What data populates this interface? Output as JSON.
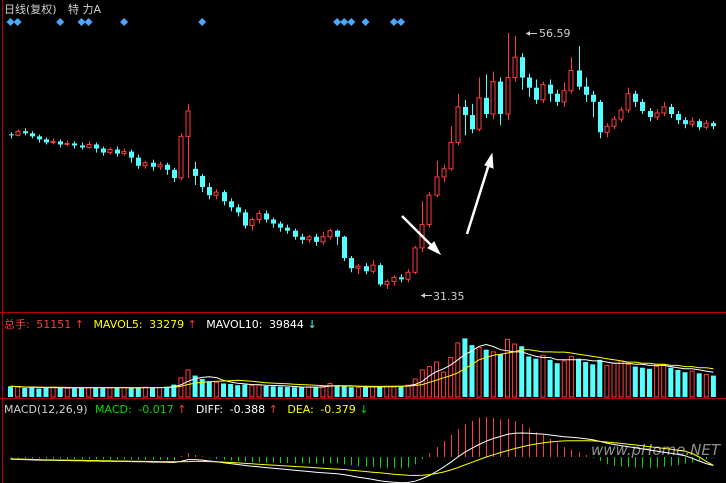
{
  "header": {
    "title": "日线(复权)",
    "extra": "特 力A"
  },
  "price_panel": {
    "high_label": "56.59",
    "low_label": "31.35"
  },
  "volume_panel": {
    "total_label": "总手:",
    "total_value": "51151",
    "total_arrow": "↑",
    "mavol5_label": "MAVOL5:",
    "mavol5_value": "33279",
    "mavol5_arrow": "↑",
    "mavol10_label": "MAVOL10:",
    "mavol10_value": "39844",
    "mavol10_arrow": "↓"
  },
  "macd_panel": {
    "name": "MACD(12,26,9)",
    "macd_label": "MACD:",
    "macd_value": "-0.017",
    "macd_arrow": "↑",
    "diff_label": "DIFF:",
    "diff_value": "-0.388",
    "diff_arrow": "↑",
    "dea_label": "DEA:",
    "dea_value": "-0.379",
    "dea_arrow": "↓"
  },
  "watermark": "www.pHome.NET",
  "colors": {
    "up": "#ff3c3c",
    "down": "#54ffff",
    "grid": "#b00000",
    "mavol5": "#ffffff",
    "mavol10": "#ffff00",
    "macd_pos": "#ff3c3c",
    "macd_neg": "#00d800",
    "marker": "#4aa8ff"
  },
  "chart_data": {
    "type": "candlestick",
    "price_high": 56.59,
    "price_low": 31.35,
    "candles": [
      [
        46.6,
        46.5,
        46.8,
        46.2
      ],
      [
        46.5,
        46.9,
        47.1,
        46.4
      ],
      [
        46.9,
        46.7,
        47.2,
        46.5
      ],
      [
        46.7,
        46.4,
        46.9,
        46.2
      ],
      [
        46.4,
        46.1,
        46.6,
        45.8
      ],
      [
        46.1,
        45.8,
        46.3,
        45.6
      ],
      [
        45.8,
        45.9,
        46.2,
        45.6
      ],
      [
        45.9,
        45.6,
        46.1,
        45.3
      ],
      [
        45.6,
        45.7,
        46.0,
        45.4
      ],
      [
        45.7,
        45.5,
        45.9,
        45.2
      ],
      [
        45.5,
        45.3,
        45.8,
        45.1
      ],
      [
        45.3,
        45.6,
        45.9,
        45.2
      ],
      [
        45.6,
        45.2,
        45.8,
        44.8
      ],
      [
        45.2,
        44.8,
        45.4,
        44.5
      ],
      [
        44.8,
        45.1,
        45.3,
        44.6
      ],
      [
        45.1,
        44.7,
        45.4,
        44.4
      ],
      [
        44.7,
        44.9,
        45.2,
        44.5
      ],
      [
        44.9,
        44.3,
        45.1,
        43.8
      ],
      [
        44.3,
        43.5,
        44.6,
        43.2
      ],
      [
        43.5,
        43.8,
        44.0,
        43.2
      ],
      [
        43.8,
        43.4,
        44.1,
        43.0
      ],
      [
        43.4,
        43.6,
        43.9,
        43.1
      ],
      [
        43.6,
        43.1,
        43.8,
        42.6
      ],
      [
        43.1,
        42.3,
        43.3,
        41.9
      ],
      [
        42.3,
        46.4,
        46.7,
        42.1
      ],
      [
        46.4,
        48.9,
        49.6,
        42.3
      ],
      [
        43.2,
        42.5,
        43.9,
        41.6
      ],
      [
        42.5,
        41.4,
        42.7,
        40.9
      ],
      [
        41.4,
        40.6,
        41.8,
        40.2
      ],
      [
        40.6,
        40.9,
        41.2,
        40.2
      ],
      [
        40.9,
        40.0,
        41.1,
        39.6
      ],
      [
        40.0,
        39.4,
        40.3,
        39.0
      ],
      [
        39.4,
        38.9,
        39.7,
        38.5
      ],
      [
        38.9,
        37.6,
        39.2,
        37.3
      ],
      [
        37.6,
        38.2,
        38.4,
        37.1
      ],
      [
        38.2,
        38.8,
        39.1,
        37.8
      ],
      [
        38.8,
        38.2,
        39.1,
        37.9
      ],
      [
        38.2,
        37.8,
        38.4,
        37.4
      ],
      [
        37.8,
        37.4,
        38.0,
        37.0
      ],
      [
        37.4,
        37.1,
        37.7,
        36.8
      ],
      [
        37.1,
        36.5,
        37.3,
        36.2
      ],
      [
        36.5,
        36.2,
        36.8,
        35.8
      ],
      [
        36.2,
        36.5,
        36.7,
        35.9
      ],
      [
        36.5,
        36.0,
        36.8,
        35.6
      ],
      [
        36.0,
        36.5,
        37.0,
        35.7
      ],
      [
        36.5,
        37.1,
        37.3,
        36.2
      ],
      [
        37.1,
        36.5,
        37.2,
        35.7
      ],
      [
        36.5,
        34.4,
        36.6,
        34.1
      ],
      [
        34.4,
        33.4,
        34.6,
        33.0
      ],
      [
        33.4,
        33.6,
        33.8,
        32.8
      ],
      [
        33.6,
        33.1,
        33.9,
        32.8
      ],
      [
        33.1,
        33.7,
        34.2,
        32.9
      ],
      [
        33.7,
        31.8,
        33.9,
        31.6
      ],
      [
        31.8,
        32.1,
        32.3,
        31.35
      ],
      [
        32.1,
        32.5,
        32.7,
        31.7
      ],
      [
        32.5,
        32.3,
        32.8,
        32.0
      ],
      [
        32.3,
        33.0,
        33.3,
        32.0
      ],
      [
        33.0,
        35.4,
        35.6,
        32.8
      ],
      [
        35.4,
        37.7,
        40.0,
        35.0
      ],
      [
        37.7,
        40.6,
        40.9,
        37.4
      ],
      [
        40.6,
        42.4,
        44.0,
        40.4
      ],
      [
        42.4,
        43.2,
        43.6,
        41.9
      ],
      [
        43.2,
        45.8,
        47.4,
        43.0
      ],
      [
        45.8,
        49.3,
        50.6,
        45.5
      ],
      [
        49.3,
        48.5,
        50.0,
        46.5
      ],
      [
        48.5,
        47.1,
        49.6,
        46.7
      ],
      [
        47.1,
        50.2,
        52.2,
        46.9
      ],
      [
        50.2,
        48.6,
        52.5,
        48.2
      ],
      [
        48.6,
        51.8,
        52.8,
        48.1
      ],
      [
        51.8,
        48.6,
        52.2,
        47.5
      ],
      [
        48.6,
        52.2,
        56.59,
        48.0
      ],
      [
        52.2,
        54.2,
        56.3,
        51.8
      ],
      [
        54.2,
        52.2,
        54.6,
        51.0
      ],
      [
        52.2,
        51.2,
        52.6,
        50.3
      ],
      [
        51.2,
        50.0,
        52.0,
        49.6
      ],
      [
        50.0,
        51.5,
        51.8,
        49.7
      ],
      [
        51.5,
        50.6,
        52.0,
        49.8
      ],
      [
        50.6,
        49.8,
        51.0,
        49.4
      ],
      [
        49.8,
        50.9,
        51.7,
        49.3
      ],
      [
        50.9,
        52.9,
        54.2,
        50.6
      ],
      [
        52.9,
        51.3,
        55.3,
        51.0
      ],
      [
        51.3,
        50.5,
        52.2,
        49.8
      ],
      [
        50.5,
        49.8,
        50.9,
        48.3
      ],
      [
        49.8,
        46.8,
        50.0,
        46.2
      ],
      [
        46.8,
        47.4,
        47.7,
        46.3
      ],
      [
        47.4,
        48.1,
        48.4,
        47.1
      ],
      [
        48.1,
        49.0,
        49.3,
        47.8
      ],
      [
        49.0,
        50.6,
        51.2,
        48.7
      ],
      [
        50.6,
        49.8,
        50.9,
        49.3
      ],
      [
        49.8,
        48.9,
        50.1,
        48.6
      ],
      [
        48.9,
        48.3,
        49.2,
        47.9
      ],
      [
        48.3,
        48.7,
        49.1,
        48.0
      ],
      [
        48.7,
        49.3,
        49.8,
        48.4
      ],
      [
        49.3,
        48.6,
        49.6,
        48.2
      ],
      [
        48.6,
        48.0,
        48.9,
        47.6
      ],
      [
        48.0,
        47.6,
        48.3,
        47.2
      ],
      [
        47.6,
        47.9,
        48.3,
        47.3
      ],
      [
        47.9,
        47.3,
        48.1,
        47.0
      ],
      [
        47.3,
        47.7,
        48.0,
        47.1
      ],
      [
        47.7,
        47.4,
        47.9,
        47.1
      ]
    ],
    "volumes": [
      9500,
      9000,
      8000,
      8500,
      7500,
      8200,
      8800,
      8000,
      7800,
      7600,
      8400,
      8100,
      8600,
      8300,
      8000,
      8200,
      8500,
      7900,
      8300,
      8700,
      8000,
      8400,
      9200,
      11000,
      17000,
      24000,
      19000,
      16000,
      14000,
      13000,
      12000,
      11500,
      10500,
      11000,
      10000,
      10800,
      9800,
      9500,
      9200,
      8800,
      8600,
      8500,
      9000,
      8800,
      9600,
      12000,
      10000,
      9300,
      8700,
      8400,
      8800,
      9000,
      9200,
      9500,
      8900,
      9800,
      10500,
      16000,
      24000,
      27000,
      31000,
      22000,
      35000,
      48000,
      52000,
      46000,
      44000,
      42000,
      40000,
      38000,
      51151,
      47000,
      45000,
      36000,
      34000,
      37000,
      33000,
      30000,
      32000,
      36000,
      34000,
      31000,
      29000,
      33000,
      28000,
      30000,
      32000,
      29000,
      27000,
      26000,
      25000,
      27000,
      29000,
      26000,
      24000,
      22000,
      23000,
      21000,
      20000,
      19000
    ],
    "mavol5": [
      9500,
      9200,
      8800,
      8700,
      8500,
      8300,
      8400,
      8300,
      8100,
      8100,
      8200,
      8200,
      8300,
      8300,
      8300,
      8300,
      8300,
      8200,
      8200,
      8300,
      8300,
      8300,
      8500,
      9100,
      10700,
      13900,
      16200,
      17400,
      18000,
      17200,
      14800,
      13300,
      12200,
      11600,
      11000,
      10800,
      10400,
      10200,
      10100,
      9800,
      9300,
      8900,
      8800,
      8800,
      8900,
      9700,
      9900,
      10000,
      9900,
      9600,
      9000,
      9000,
      9000,
      9100,
      9200,
      9500,
      9900,
      11200,
      13800,
      18800,
      22500,
      25000,
      28500,
      33000,
      37600,
      41000,
      45000,
      46600,
      44800,
      42000,
      41000,
      40000,
      40000,
      38000,
      36000,
      35000,
      35000,
      33000,
      33000,
      33000,
      33000,
      33000,
      32000,
      32000,
      31000,
      30000,
      30000,
      30000,
      29000,
      29000,
      28000,
      28000,
      28000,
      27000,
      26000,
      25000,
      25000,
      24000,
      23000,
      22000
    ],
    "mavol10": [
      9500,
      9200,
      9000,
      8900,
      8800,
      8700,
      8700,
      8600,
      8500,
      8400,
      8300,
      8300,
      8300,
      8300,
      8300,
      8300,
      8300,
      8200,
      8200,
      8300,
      8300,
      8300,
      8400,
      8700,
      9500,
      11100,
      12300,
      13000,
      13600,
      14000,
      14200,
      14500,
      14800,
      14500,
      14000,
      13300,
      12700,
      12300,
      12000,
      11700,
      11300,
      11000,
      10700,
      10400,
      10100,
      10000,
      9900,
      9800,
      9700,
      9600,
      9500,
      9400,
      9400,
      9400,
      9500,
      9600,
      9700,
      10200,
      11000,
      13000,
      15000,
      17000,
      19000,
      21500,
      25000,
      29000,
      33000,
      35000,
      37000,
      38000,
      39000,
      40000,
      42000,
      42000,
      41000,
      40000,
      40000,
      39800,
      39844,
      39000,
      38000,
      37000,
      36000,
      35000,
      34000,
      33000,
      32000,
      31000,
      31000,
      30000,
      30000,
      29000,
      29000,
      28000,
      28000,
      27000,
      27000,
      26000,
      26000,
      25000
    ],
    "macd_hist": [
      -0.02,
      -0.02,
      -0.03,
      -0.03,
      -0.03,
      -0.04,
      -0.04,
      -0.04,
      -0.05,
      -0.05,
      -0.05,
      -0.05,
      -0.06,
      -0.06,
      -0.06,
      -0.06,
      -0.06,
      -0.07,
      -0.07,
      -0.07,
      -0.07,
      -0.07,
      -0.08,
      -0.08,
      0.03,
      0.1,
      0.05,
      0.02,
      -0.02,
      -0.05,
      -0.07,
      -0.09,
      -0.1,
      -0.12,
      -0.13,
      -0.13,
      -0.14,
      -0.14,
      -0.15,
      -0.15,
      -0.16,
      -0.16,
      -0.16,
      -0.17,
      -0.17,
      -0.16,
      -0.16,
      -0.18,
      -0.21,
      -0.23,
      -0.24,
      -0.25,
      -0.27,
      -0.28,
      -0.28,
      -0.28,
      -0.26,
      -0.18,
      -0.05,
      0.1,
      0.25,
      0.4,
      0.55,
      0.7,
      0.82,
      0.9,
      0.98,
      1.0,
      0.98,
      0.94,
      0.95,
      0.9,
      0.82,
      0.72,
      0.62,
      0.55,
      0.45,
      0.35,
      0.25,
      0.18,
      0.12,
      0.05,
      -0.02,
      -0.1,
      -0.18,
      -0.22,
      -0.24,
      -0.25,
      -0.26,
      -0.27,
      -0.27,
      -0.26,
      -0.24,
      -0.22,
      -0.2,
      -0.17,
      -0.14,
      -0.1,
      -0.06,
      -0.017
    ],
    "diff": [
      -0.1,
      -0.11,
      -0.12,
      -0.13,
      -0.14,
      -0.15,
      -0.15,
      -0.16,
      -0.16,
      -0.17,
      -0.17,
      -0.18,
      -0.18,
      -0.19,
      -0.19,
      -0.2,
      -0.2,
      -0.21,
      -0.22,
      -0.22,
      -0.23,
      -0.23,
      -0.24,
      -0.25,
      -0.2,
      -0.12,
      -0.12,
      -0.14,
      -0.18,
      -0.22,
      -0.26,
      -0.3,
      -0.34,
      -0.38,
      -0.42,
      -0.45,
      -0.48,
      -0.51,
      -0.54,
      -0.57,
      -0.6,
      -0.63,
      -0.66,
      -0.69,
      -0.72,
      -0.74,
      -0.76,
      -0.8,
      -0.86,
      -0.92,
      -0.97,
      -1.02,
      -1.08,
      -1.12,
      -1.15,
      -1.17,
      -1.16,
      -1.1,
      -0.98,
      -0.84,
      -0.66,
      -0.46,
      -0.24,
      0.0,
      0.22,
      0.4,
      0.57,
      0.72,
      0.84,
      0.93,
      1.03,
      1.08,
      1.09,
      1.08,
      1.06,
      1.04,
      1.0,
      0.96,
      0.92,
      0.9,
      0.87,
      0.83,
      0.78,
      0.71,
      0.63,
      0.57,
      0.52,
      0.47,
      0.42,
      0.37,
      0.32,
      0.27,
      0.22,
      0.17,
      0.12,
      0.06,
      -0.06,
      -0.18,
      -0.3,
      -0.388
    ],
    "dea": [
      -0.08,
      -0.09,
      -0.1,
      -0.11,
      -0.12,
      -0.13,
      -0.13,
      -0.14,
      -0.14,
      -0.15,
      -0.15,
      -0.16,
      -0.16,
      -0.17,
      -0.17,
      -0.18,
      -0.18,
      -0.19,
      -0.19,
      -0.2,
      -0.2,
      -0.21,
      -0.21,
      -0.22,
      -0.22,
      -0.21,
      -0.2,
      -0.2,
      -0.21,
      -0.22,
      -0.23,
      -0.25,
      -0.27,
      -0.29,
      -0.31,
      -0.33,
      -0.35,
      -0.37,
      -0.39,
      -0.41,
      -0.43,
      -0.45,
      -0.47,
      -0.49,
      -0.51,
      -0.53,
      -0.55,
      -0.57,
      -0.6,
      -0.63,
      -0.66,
      -0.69,
      -0.72,
      -0.75,
      -0.78,
      -0.81,
      -0.83,
      -0.84,
      -0.83,
      -0.8,
      -0.75,
      -0.68,
      -0.59,
      -0.48,
      -0.36,
      -0.24,
      -0.12,
      0.0,
      0.1,
      0.2,
      0.29,
      0.38,
      0.46,
      0.53,
      0.59,
      0.64,
      0.68,
      0.71,
      0.73,
      0.74,
      0.74,
      0.74,
      0.73,
      0.71,
      0.68,
      0.65,
      0.62,
      0.58,
      0.55,
      0.51,
      0.47,
      0.43,
      0.39,
      0.35,
      0.31,
      0.26,
      0.16,
      0.0,
      -0.2,
      -0.379
    ],
    "markers": [
      0,
      1,
      7,
      10,
      11,
      16,
      27,
      46,
      47,
      48,
      50,
      54,
      55
    ]
  }
}
